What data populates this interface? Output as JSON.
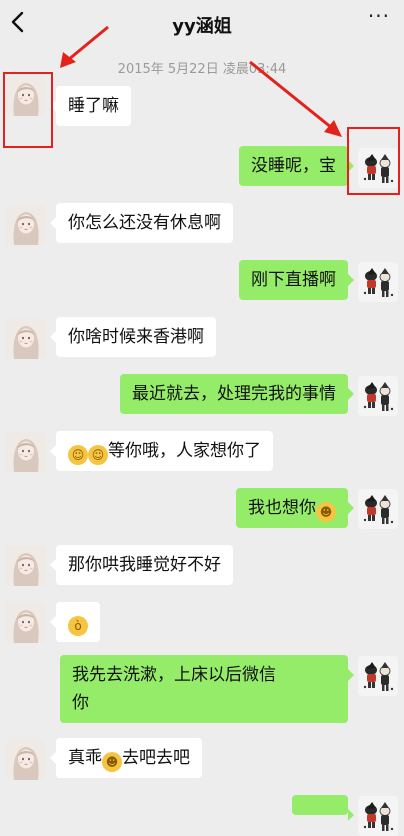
{
  "header": {
    "title": "yy涵姐",
    "more_glyph": "···"
  },
  "timestamp": "2015年 5月22日 凌晨03:44",
  "messages": [
    {
      "side": "left",
      "text": "睡了嘛"
    },
    {
      "side": "right",
      "text": "没睡呢，宝"
    },
    {
      "side": "left",
      "text": "你怎么还没有休息啊"
    },
    {
      "side": "right",
      "text": "刚下直播啊"
    },
    {
      "side": "left",
      "text": "你啥时候来香港啊"
    },
    {
      "side": "right",
      "text": "最近就去，处理完我的事情"
    },
    {
      "side": "left",
      "text": "等你哦，人家想你了",
      "emoji_before": [
        "blush-hands-emoji",
        "blush-hands-emoji"
      ]
    },
    {
      "side": "right",
      "text": "我也想你",
      "emoji_after": "smile-emoji"
    },
    {
      "side": "left",
      "text": "那你哄我睡觉好不好"
    },
    {
      "side": "left",
      "text": "",
      "emoji_only": "angry-emoji"
    },
    {
      "side": "right",
      "line1": "我先去洗漱，上床以后微信",
      "line2": "你"
    },
    {
      "side": "left",
      "text_before": "真乖",
      "text_after": "去吧去吧",
      "emoji_mid": "grin-emoji"
    }
  ],
  "colors": {
    "background": "#ededed",
    "sent_bubble": "#95ec69",
    "received_bubble": "#ffffff",
    "annotation": "#e3231b"
  }
}
